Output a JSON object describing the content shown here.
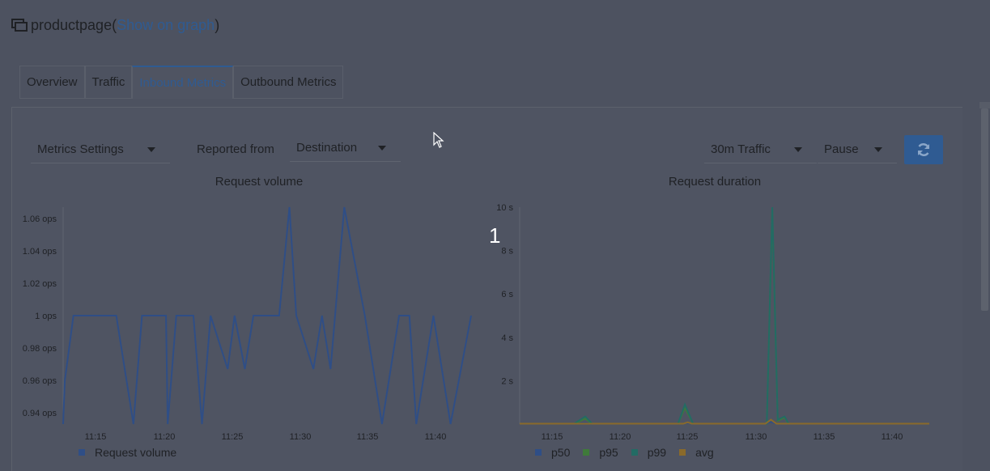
{
  "header": {
    "title": "productpage",
    "paren_open": " (",
    "graph_link": "Show on graph",
    "paren_close": ")"
  },
  "tabs": [
    {
      "label": "Overview",
      "active": false
    },
    {
      "label": "Traffic",
      "active": false
    },
    {
      "label": "Inbound Metrics",
      "active": true
    },
    {
      "label": "Outbound Metrics",
      "active": false
    }
  ],
  "toolbar": {
    "metrics_settings": "Metrics Settings",
    "reported_from_label": "Reported from",
    "reported_from_value": "Destination",
    "traffic_range": "30m Traffic",
    "refresh_interval": "Pause",
    "refresh_icon": "sync-icon"
  },
  "overlay_marker": "1",
  "colors": {
    "accent": "#2f5b92",
    "request_volume": "#2f4e86",
    "p50": "#2f4e86",
    "p95": "#3f7a3a",
    "p99": "#236b64",
    "avg": "#8a6a2a"
  },
  "chart_data": [
    {
      "type": "line",
      "title": "Request volume",
      "xlabel": "",
      "ylabel": "",
      "x_ticks": [
        "11:15",
        "11:20",
        "11:25",
        "11:30",
        "11:35",
        "11:40"
      ],
      "y_ticks": [
        "0.94 ops",
        "0.96 ops",
        "0.98 ops",
        "1 ops",
        "1.02 ops",
        "1.04 ops",
        "1.06 ops"
      ],
      "ylim": [
        0.933,
        1.067
      ],
      "xlim": [
        11.2,
        11.75
      ],
      "series": [
        {
          "name": "Request volume",
          "x": [
            11.2,
            11.25,
            11.5,
            11.7,
            11.75,
            12.25,
            12.5,
            12.7,
            12.75,
            13.25,
            13.5,
            13.7,
            13.75,
            14.0,
            14.2,
            14.25,
            14.5,
            14.8,
            15.0,
            15.25,
            15.5,
            16.0,
            16.2,
            16.5,
            16.75,
            17.0,
            17.2,
            17.5,
            17.8,
            18.0,
            18.5,
            18.75,
            19.0,
            19.4,
            20.0,
            20.5,
            21.0,
            21.3,
            21.5,
            22.0,
            22.5,
            23.1
          ],
          "y": [
            0.933,
            0.96,
            1.0,
            1.0,
            1.0,
            1.0,
            1.0,
            1.0,
            1.0,
            0.933,
            1.0,
            1.0,
            1.0,
            1.0,
            1.0,
            0.933,
            1.0,
            1.0,
            1.0,
            0.933,
            1.0,
            0.967,
            1.0,
            0.967,
            1.0,
            1.0,
            1.0,
            1.0,
            1.067,
            1.0,
            0.967,
            1.0,
            0.967,
            1.067,
            1.0,
            0.933,
            1.0,
            1.0,
            0.933,
            1.0,
            0.933,
            1.0
          ]
        }
      ],
      "legend": [
        "Request volume"
      ],
      "legend_position": "bottom-left"
    },
    {
      "type": "line",
      "title": "Request duration",
      "xlabel": "",
      "ylabel": "",
      "x_ticks": [
        "11:15",
        "11:20",
        "11:25",
        "11:30",
        "11:35",
        "11:40"
      ],
      "y_ticks": [
        "2 s",
        "4 s",
        "6 s",
        "8 s",
        "10 s"
      ],
      "ylim": [
        0,
        10
      ],
      "series": [
        {
          "name": "p50",
          "x": [
            0,
            4,
            4.8,
            5.3,
            12,
            12.3,
            12.6,
            18,
            18.4,
            18.8,
            30
          ],
          "y": [
            0.02,
            0.02,
            0.05,
            0.02,
            0.02,
            0.05,
            0.02,
            0.02,
            0.1,
            0.02,
            0.02
          ]
        },
        {
          "name": "p95",
          "x": [
            0,
            4,
            4.8,
            5.3,
            11.6,
            12.1,
            12.7,
            18.1,
            18.5,
            18.9,
            19.4,
            19.7,
            30
          ],
          "y": [
            0.02,
            0.02,
            0.25,
            0.02,
            0.02,
            0.75,
            0.02,
            0.02,
            9.9,
            0.15,
            0.3,
            0.02,
            0.02
          ]
        },
        {
          "name": "p99",
          "x": [
            0,
            4,
            4.8,
            5.3,
            11.6,
            12.1,
            12.7,
            18.1,
            18.5,
            18.9,
            19.4,
            19.7,
            30
          ],
          "y": [
            0.02,
            0.02,
            0.35,
            0.02,
            0.02,
            0.9,
            0.02,
            0.02,
            10.0,
            0.2,
            0.35,
            0.02,
            0.02
          ]
        },
        {
          "name": "avg",
          "x": [
            0,
            12,
            12.3,
            12.6,
            18,
            18.4,
            18.8,
            30
          ],
          "y": [
            0.02,
            0.02,
            0.08,
            0.02,
            0.02,
            0.2,
            0.02,
            0.02
          ]
        }
      ],
      "legend": [
        "p50",
        "p95",
        "p99",
        "avg"
      ],
      "legend_position": "bottom-left"
    }
  ]
}
